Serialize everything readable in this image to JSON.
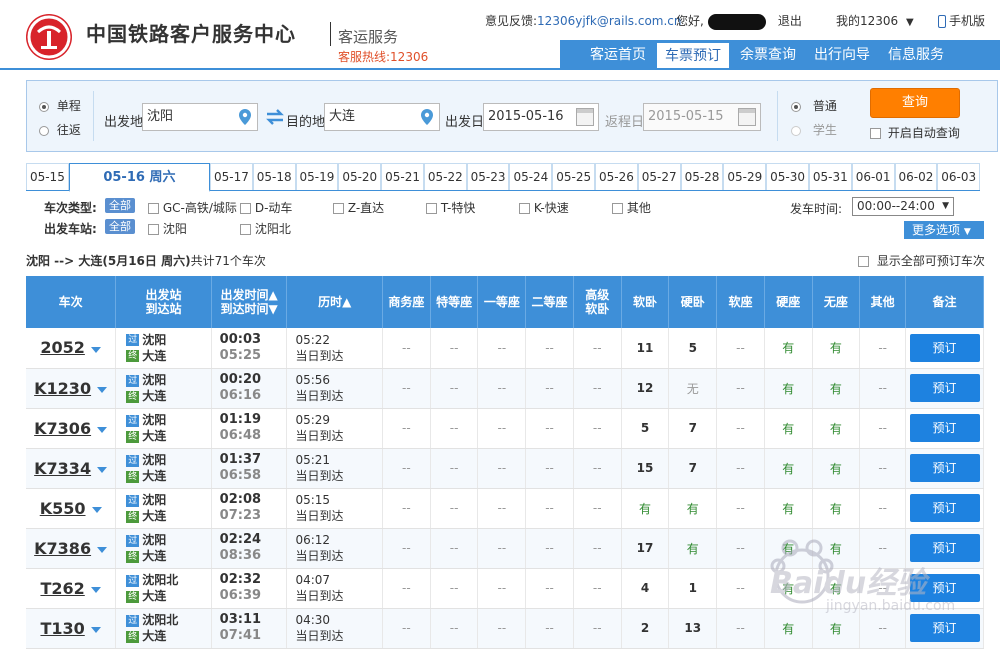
{
  "header": {
    "site_title": "中国铁路客户服务中心",
    "subtitle": "客运服务",
    "hotline": "客服热线:12306",
    "feedback_label": "意见反馈:",
    "feedback_email": "12306yjfk@rails.com.cn",
    "greeting": "您好,",
    "logout": "退出",
    "my12306": "我的12306",
    "mobile": "手机版",
    "nav": [
      "客运首页",
      "车票预订",
      "余票查询",
      "出行向导",
      "信息服务"
    ],
    "nav_active": 1
  },
  "search": {
    "trip_oneway": "单程",
    "trip_round": "往返",
    "from_label": "出发地",
    "from_value": "沈阳",
    "to_label": "目的地",
    "to_value": "大连",
    "depart_label": "出发日",
    "depart_value": "2015-05-16",
    "return_label": "返程日",
    "return_value": "2015-05-15",
    "ticket_normal": "普通",
    "ticket_student": "学生",
    "query_button": "查询",
    "auto_query": "开启自动查询"
  },
  "dates": [
    "05-15",
    "05-16 周六",
    "05-17",
    "05-18",
    "05-19",
    "05-20",
    "05-21",
    "05-22",
    "05-23",
    "05-24",
    "05-25",
    "05-26",
    "05-27",
    "05-28",
    "05-29",
    "05-30",
    "05-31",
    "06-01",
    "06-02",
    "06-03"
  ],
  "filters": {
    "type_label": "车次类型:",
    "station_label": "出发车站:",
    "all": "全部",
    "types": [
      "GC-高铁/城际",
      "D-动车",
      "Z-直达",
      "T-特快",
      "K-快速",
      "其他"
    ],
    "stations": [
      "沈阳",
      "沈阳北"
    ],
    "time_label": "发车时间:",
    "time_value": "00:00--24:00",
    "more_options": "更多选项"
  },
  "summary": {
    "route": "沈阳 --> 大连(5月16日 周六)",
    "count": "共计71个车次",
    "show_all": "显示全部可预订车次"
  },
  "table": {
    "headers": {
      "train": "车次",
      "station1": "出发站",
      "station2": "到达站",
      "time1": "出发时间▲",
      "time2": "到达时间▼",
      "duration": "历时▲",
      "business": "商务座",
      "premium": "特等座",
      "first": "一等座",
      "second": "二等座",
      "adv_soft1": "高级",
      "adv_soft2": "软卧",
      "soft_sleeper": "软卧",
      "hard_sleeper": "硬卧",
      "soft_seat": "软座",
      "hard_seat": "硬座",
      "standing": "无座",
      "other": "其他",
      "remark": "备注"
    },
    "pass_icon": "过",
    "end_icon": "终",
    "rows": [
      {
        "train": "2052",
        "from": "沈阳",
        "to": "大连",
        "dep": "00:03",
        "arr": "05:25",
        "dur": "05:22",
        "dur_note": "当日到达",
        "seats": [
          "--",
          "--",
          "--",
          "--",
          "--",
          "11",
          "5",
          "--",
          "有",
          "有",
          "--"
        ],
        "book": "预订"
      },
      {
        "train": "K1230",
        "from": "沈阳",
        "to": "大连",
        "dep": "00:20",
        "arr": "06:16",
        "dur": "05:56",
        "dur_note": "当日到达",
        "seats": [
          "--",
          "--",
          "--",
          "--",
          "--",
          "12",
          "无",
          "--",
          "有",
          "有",
          "--"
        ],
        "book": "预订"
      },
      {
        "train": "K7306",
        "from": "沈阳",
        "to": "大连",
        "dep": "01:19",
        "arr": "06:48",
        "dur": "05:29",
        "dur_note": "当日到达",
        "seats": [
          "--",
          "--",
          "--",
          "--",
          "--",
          "5",
          "7",
          "--",
          "有",
          "有",
          "--"
        ],
        "book": "预订"
      },
      {
        "train": "K7334",
        "from": "沈阳",
        "to": "大连",
        "dep": "01:37",
        "arr": "06:58",
        "dur": "05:21",
        "dur_note": "当日到达",
        "seats": [
          "--",
          "--",
          "--",
          "--",
          "--",
          "15",
          "7",
          "--",
          "有",
          "有",
          "--"
        ],
        "book": "预订"
      },
      {
        "train": "K550",
        "from": "沈阳",
        "to": "大连",
        "dep": "02:08",
        "arr": "07:23",
        "dur": "05:15",
        "dur_note": "当日到达",
        "seats": [
          "--",
          "--",
          "--",
          "--",
          "--",
          "有",
          "有",
          "--",
          "有",
          "有",
          "--"
        ],
        "book": "预订"
      },
      {
        "train": "K7386",
        "from": "沈阳",
        "to": "大连",
        "dep": "02:24",
        "arr": "08:36",
        "dur": "06:12",
        "dur_note": "当日到达",
        "seats": [
          "--",
          "--",
          "--",
          "--",
          "--",
          "17",
          "有",
          "--",
          "有",
          "有",
          "--"
        ],
        "book": "预订"
      },
      {
        "train": "T262",
        "from": "沈阳北",
        "to": "大连",
        "dep": "02:32",
        "arr": "06:39",
        "dur": "04:07",
        "dur_note": "当日到达",
        "seats": [
          "--",
          "--",
          "--",
          "--",
          "--",
          "4",
          "1",
          "--",
          "有",
          "有",
          "--"
        ],
        "book": "预订"
      },
      {
        "train": "T130",
        "from": "沈阳北",
        "to": "大连",
        "dep": "03:11",
        "arr": "07:41",
        "dur": "04:30",
        "dur_note": "当日到达",
        "seats": [
          "--",
          "--",
          "--",
          "--",
          "--",
          "2",
          "13",
          "--",
          "有",
          "有",
          "--"
        ],
        "book": "预订"
      }
    ]
  },
  "watermark": {
    "text": "Baidu经验",
    "url": "jingyan.baidu.com"
  },
  "colors": {
    "brand_blue": "#3e8fd8",
    "orange": "#ff7f00",
    "red": "#d8232a",
    "book_blue": "#1e82e0",
    "green": "#2f8a2f"
  }
}
